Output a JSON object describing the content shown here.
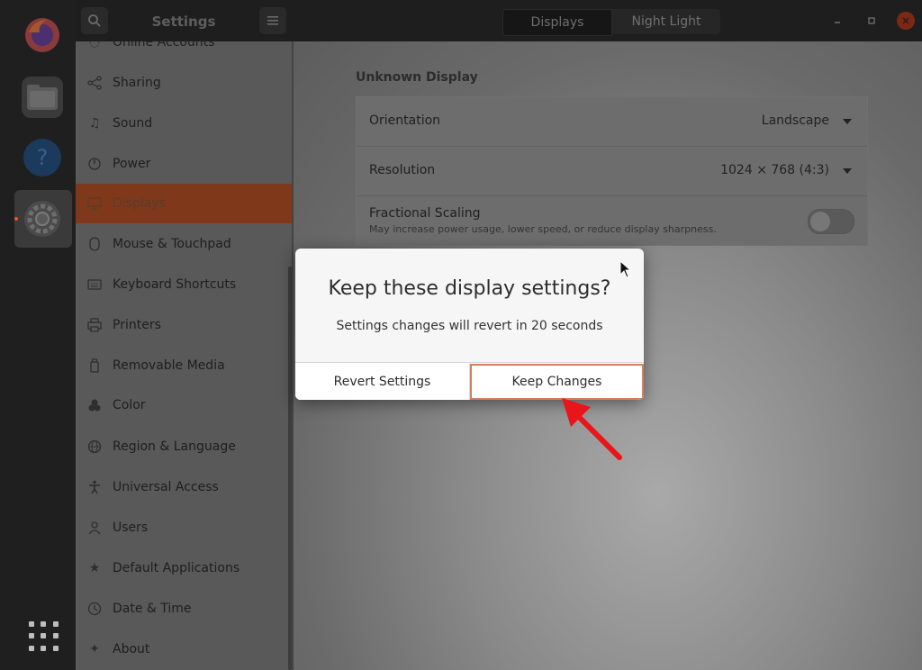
{
  "header": {
    "title": "Settings",
    "tabs": [
      {
        "label": "Displays",
        "active": true
      },
      {
        "label": "Night Light",
        "active": false
      }
    ]
  },
  "sidebar": {
    "items": [
      {
        "label": "Online Accounts",
        "icon": "online-accounts-icon"
      },
      {
        "label": "Sharing",
        "icon": "share-icon"
      },
      {
        "label": "Sound",
        "icon": "music-note-icon"
      },
      {
        "label": "Power",
        "icon": "power-icon"
      },
      {
        "label": "Displays",
        "icon": "display-icon",
        "active": true
      },
      {
        "label": "Mouse & Touchpad",
        "icon": "mouse-icon"
      },
      {
        "label": "Keyboard Shortcuts",
        "icon": "keyboard-icon"
      },
      {
        "label": "Printers",
        "icon": "printer-icon"
      },
      {
        "label": "Removable Media",
        "icon": "removable-media-icon"
      },
      {
        "label": "Color",
        "icon": "color-icon"
      },
      {
        "label": "Region & Language",
        "icon": "globe-icon"
      },
      {
        "label": "Universal Access",
        "icon": "accessibility-icon"
      },
      {
        "label": "Users",
        "icon": "user-icon"
      },
      {
        "label": "Default Applications",
        "icon": "star-icon"
      },
      {
        "label": "Date & Time",
        "icon": "clock-icon"
      },
      {
        "label": "About",
        "icon": "plus-icon"
      }
    ]
  },
  "display": {
    "section_title": "Unknown Display",
    "orientation": {
      "label": "Orientation",
      "value": "Landscape"
    },
    "resolution": {
      "label": "Resolution",
      "value": "1024 × 768 (4:3)"
    },
    "fractional_scaling": {
      "label": "Fractional Scaling",
      "description": "May increase power usage, lower speed, or reduce display sharpness.",
      "enabled": false
    }
  },
  "dialog": {
    "title": "Keep these display settings?",
    "message": "Settings changes will revert in 20 seconds",
    "revert_label": "Revert Settings",
    "keep_label": "Keep Changes"
  },
  "colors": {
    "accent": "#e95420",
    "annotation_arrow": "#e8161b"
  }
}
